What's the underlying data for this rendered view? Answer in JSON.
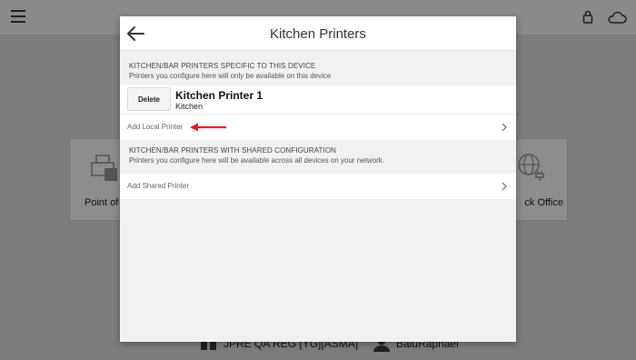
{
  "app": {
    "left_tile_label": "Point of S",
    "right_tile_label": "ck Office",
    "footer_device": "JPRE QA REG [YG][ASMA]",
    "footer_user": "BaluRaphael"
  },
  "dialog": {
    "title": "Kitchen Printers",
    "local_section": {
      "title": "KITCHEN/BAR PRINTERS SPECIFIC TO THIS DEVICE",
      "description": "Printers you configure here will only be available on this device"
    },
    "printers": [
      {
        "name": "Kitchen Printer 1",
        "subtitle": "Kitchen",
        "delete_label": "Delete"
      }
    ],
    "add_local_label": "Add Local Printer",
    "shared_section": {
      "title": "KITCHEN/BAR PRINTERS WITH SHARED CONFIGURATION",
      "description": "Printers you configure here will be available across all devices on your network."
    },
    "add_shared_label": "Add Shared Printer"
  },
  "colors": {
    "annotation_arrow": "#e02020",
    "overlay": "#7d7d7d"
  },
  "icons": [
    "hamburger-icon",
    "lock-icon",
    "cloud-icon",
    "back-arrow-icon",
    "chevron-right-icon",
    "printer-icon",
    "globe-plug-icon"
  ]
}
